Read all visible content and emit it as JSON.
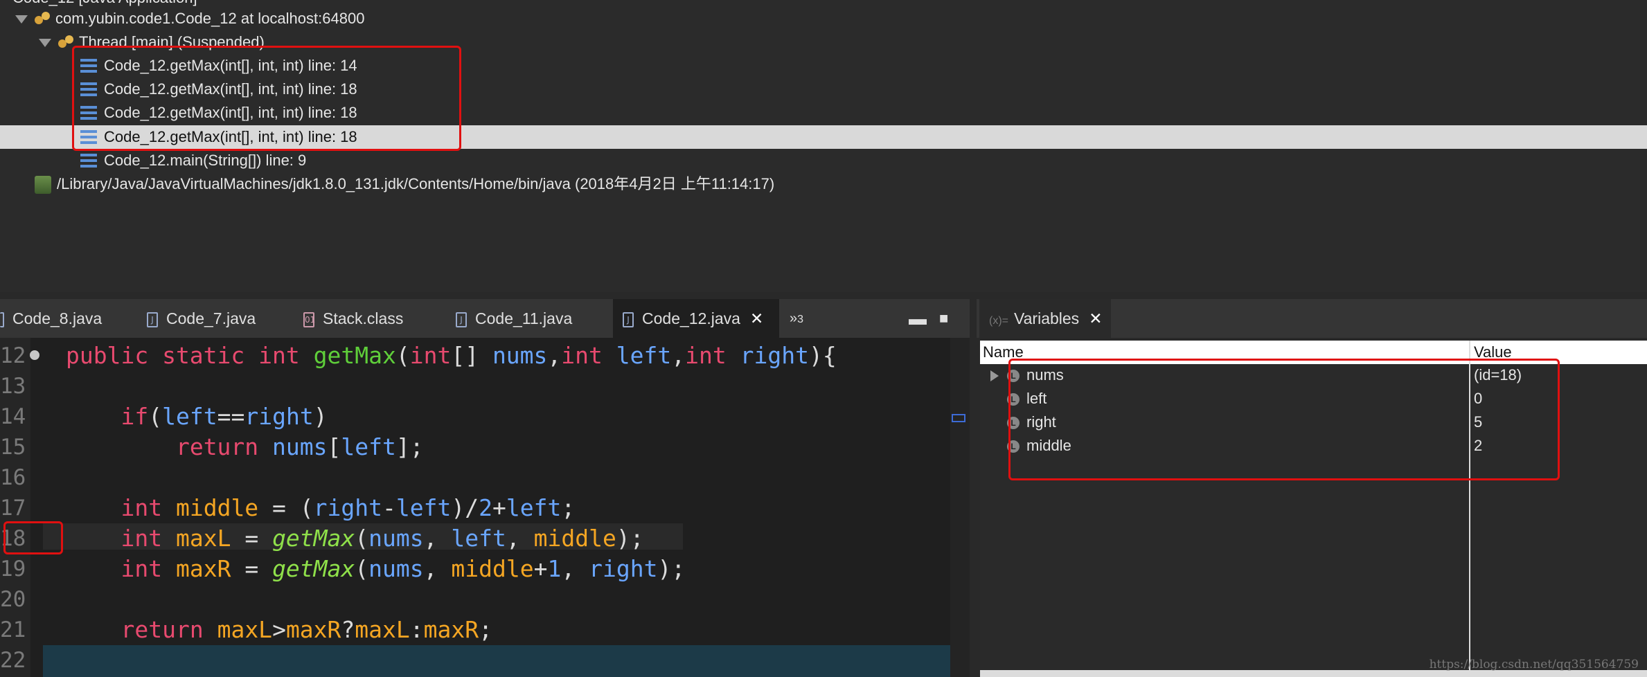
{
  "debug": {
    "top_partial": "Code_12 [Java Application]",
    "target": "com.yubin.code1.Code_12 at localhost:64800",
    "thread": "Thread [main] (Suspended)",
    "frames": [
      "Code_12.getMax(int[], int, int) line: 14",
      "Code_12.getMax(int[], int, int) line: 18",
      "Code_12.getMax(int[], int, int) line: 18",
      "Code_12.getMax(int[], int, int) line: 18",
      "Code_12.main(String[]) line: 9"
    ],
    "process": "/Library/Java/JavaVirtualMachines/jdk1.8.0_131.jdk/Contents/Home/bin/java (2018年4月2日 上午11:14:17)"
  },
  "editor": {
    "tabs": [
      "Code_8.java",
      "Code_7.java",
      "Stack.class",
      "Code_11.java",
      "Code_12.java"
    ],
    "overflow_label": "3",
    "line_numbers": [
      "12",
      "13",
      "14",
      "15",
      "16",
      "17",
      "18",
      "19",
      "20",
      "21",
      "22"
    ]
  },
  "variables": {
    "tab": "Variables",
    "col_name": "Name",
    "col_value": "Value",
    "rows": [
      {
        "name": "nums",
        "value": "(id=18)"
      },
      {
        "name": "left",
        "value": "0"
      },
      {
        "name": "right",
        "value": "5"
      },
      {
        "name": "middle",
        "value": "2"
      }
    ]
  },
  "watermark": "https://blog.csdn.net/qq351564759"
}
